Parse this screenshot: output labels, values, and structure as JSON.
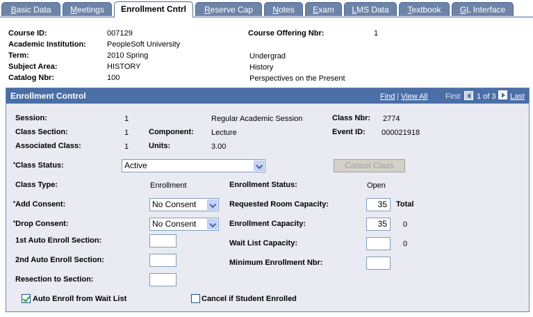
{
  "tabs": [
    {
      "label": "Basic Data"
    },
    {
      "label": "Meetings"
    },
    {
      "label": "Enrollment Cntrl"
    },
    {
      "label": "Reserve Cap"
    },
    {
      "label": "Notes"
    },
    {
      "label": "Exam"
    },
    {
      "label": "LMS Data"
    },
    {
      "label": "Textbook"
    },
    {
      "label": "GL Interface"
    }
  ],
  "header": {
    "course_id_label": "Course ID:",
    "course_id": "007129",
    "offering_label": "Course Offering Nbr:",
    "offering": "1",
    "institution_label": "Academic Institution:",
    "institution": "PeopleSoft University",
    "term_label": "Term:",
    "term": "2010 Spring",
    "career": "Undergrad",
    "subject_label": "Subject Area:",
    "subject": "HISTORY",
    "subject_desc": "History",
    "catalog_label": "Catalog Nbr:",
    "catalog": "100",
    "catalog_desc": "Perspectives on the Present"
  },
  "panel": {
    "title": "Enrollment Control",
    "find": "Find",
    "separator": "|",
    "view_all": "View All",
    "first": "First",
    "count": "1 of 3",
    "last": "Last"
  },
  "info": {
    "session_label": "Session:",
    "session": "1",
    "session_desc": "Regular Academic Session",
    "class_nbr_label": "Class Nbr:",
    "class_nbr": "2774",
    "section_label": "Class Section:",
    "section": "1",
    "component_label": "Component:",
    "component": "Lecture",
    "event_label": "Event ID:",
    "event": "000021918",
    "assoc_label": "Associated Class:",
    "assoc": "1",
    "units_label": "Units:",
    "units": "3.00"
  },
  "form": {
    "required_mark": "*",
    "class_status_label": "Class Status:",
    "class_status": "Active",
    "cancel_button": "Cancel Class",
    "class_type_label": "Class Type:",
    "class_type": "Enrollment",
    "enroll_status_label": "Enrollment Status:",
    "enroll_status": "Open",
    "add_consent_label": "Add Consent:",
    "add_consent": "No Consent",
    "room_cap_label": "Requested Room Capacity:",
    "room_cap": "35",
    "total_label": "Total",
    "drop_consent_label": "Drop Consent:",
    "drop_consent": "No Consent",
    "enroll_cap_label": "Enrollment Capacity:",
    "enroll_cap": "35",
    "enroll_total": "0",
    "auto1_label": "1st Auto Enroll Section:",
    "auto1": "",
    "waitlist_cap_label": "Wait List Capacity:",
    "waitlist_cap": "",
    "waitlist_total": "0",
    "auto2_label": "2nd Auto Enroll Section:",
    "auto2": "",
    "min_enroll_label": "Minimum Enrollment Nbr:",
    "min_enroll": "",
    "resection_label": "Resection to Section:",
    "resection": "",
    "auto_waitlist_label": "Auto Enroll from Wait List",
    "auto_waitlist_checked": true,
    "cancel_if_label": "Cancel if Student Enrolled",
    "cancel_if_checked": false
  },
  "colors": {
    "tab": "#6d84a8",
    "panel_header": "#4a6ea8",
    "panel_bg": "#e9eaf2"
  }
}
